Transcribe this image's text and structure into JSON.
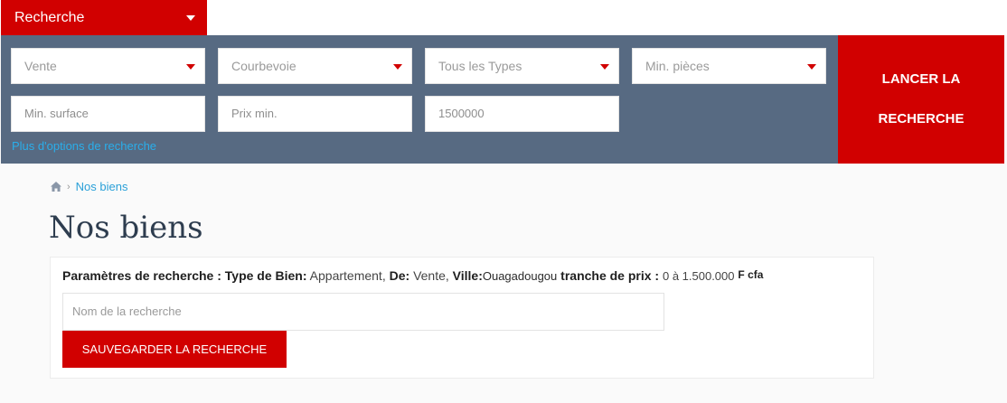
{
  "search_tab": {
    "label": "Recherche"
  },
  "filters": {
    "transaction": "Vente",
    "city": "Courbevoie",
    "type": "Tous les Types",
    "rooms": "Min. pièces",
    "surface_placeholder": "Min. surface",
    "price_min_placeholder": "Prix min.",
    "price_max_value": "1500000",
    "more_options": "Plus d'options de recherche"
  },
  "launch_button": {
    "line1": "LANCER LA",
    "line2": "RECHERCHE"
  },
  "breadcrumb": {
    "current": "Nos biens",
    "separator": "›"
  },
  "page_title": "Nos biens",
  "params": {
    "label": "Paramètres de recherche :",
    "type_label": "Type de Bien:",
    "type_value": "Appartement,",
    "de_label": "De:",
    "de_value": "Vente,",
    "ville_label": "Ville:",
    "ville_value": "Ouagadougou",
    "price_label": "tranche de prix :",
    "price_value": "0 à 1.500.000",
    "currency": "F cfa"
  },
  "save_search": {
    "name_placeholder": "Nom de la recherche",
    "button_label": "SAUVEGARDER LA RECHERCHE"
  },
  "colors": {
    "accent": "#d10000",
    "panel": "#576a82",
    "link": "#2aa0d8"
  }
}
